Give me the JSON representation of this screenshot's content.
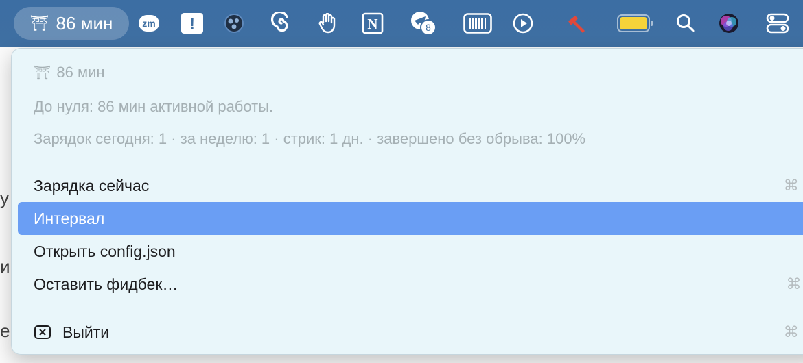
{
  "menubar": {
    "status_label": "86 мин",
    "status_icon": "⛩",
    "tray_icons": [
      {
        "name": "zoom-icon",
        "label": "zm"
      },
      {
        "name": "alert-icon",
        "label": "!"
      },
      {
        "name": "app-dots-icon"
      },
      {
        "name": "spiral-icon"
      },
      {
        "name": "hand-icon"
      },
      {
        "name": "notion-icon",
        "label": "N"
      },
      {
        "name": "telegram-icon",
        "badge": "8"
      },
      {
        "name": "barcode-icon"
      },
      {
        "name": "play-icon"
      },
      {
        "name": "hammer-icon"
      },
      {
        "name": "battery-icon"
      },
      {
        "name": "search-icon"
      },
      {
        "name": "siri-icon"
      },
      {
        "name": "control-center-icon"
      }
    ]
  },
  "menu": {
    "header_title": "86 мин",
    "header_icon": "⛩",
    "until_zero": "До нуля: 86 мин активной работы.",
    "stats": "Зарядок сегодня: 1 · за неделю: 1 · стрик: 1 дн. · завершено без обрыва: 100%",
    "items": [
      {
        "label": "Зарядка сейчас",
        "shortcut": "⌘ G"
      },
      {
        "label": "Интервал",
        "submenu": "›"
      },
      {
        "label": "Открыть config.json"
      },
      {
        "label": "Оставить фидбек…",
        "shortcut": "⌘ F"
      },
      {
        "label": "Выйти",
        "shortcut": "⌘ Q"
      }
    ]
  },
  "background": {
    "fragments": [
      "у",
      "и",
      "е"
    ]
  },
  "colors": {
    "menubar": "#3f6fa2",
    "menu_bg": "#e8f6fa",
    "selection": "#6a9ef4",
    "battery": "#f5d33a",
    "hammer": "#e2483a"
  }
}
